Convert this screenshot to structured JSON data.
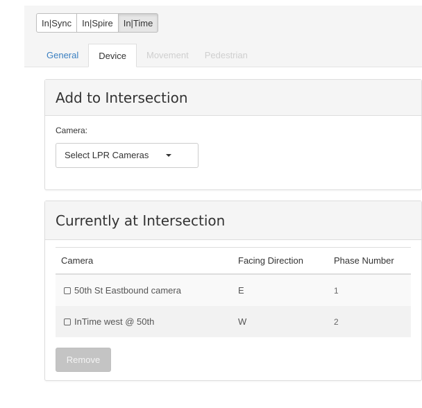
{
  "product_switcher": {
    "buttons": [
      {
        "label": "In|Sync"
      },
      {
        "label": "In|Spire"
      },
      {
        "label": "In|Time"
      }
    ]
  },
  "tabs": [
    {
      "label": "General",
      "state": "link"
    },
    {
      "label": "Device",
      "state": "active"
    },
    {
      "label": "Movement",
      "state": "disabled"
    },
    {
      "label": "Pedestrian",
      "state": "disabled"
    }
  ],
  "add_panel": {
    "title": "Add to Intersection",
    "camera_label": "Camera:",
    "select_value": "Select LPR Cameras"
  },
  "current_panel": {
    "title": "Currently at Intersection",
    "columns": [
      "Camera",
      "Facing Direction",
      "Phase Number"
    ],
    "rows": [
      {
        "camera": "50th St Eastbound camera",
        "direction": "E",
        "phase": "1"
      },
      {
        "camera": "InTime west @ 50th",
        "direction": "W",
        "phase": "2"
      }
    ],
    "remove_label": "Remove"
  }
}
